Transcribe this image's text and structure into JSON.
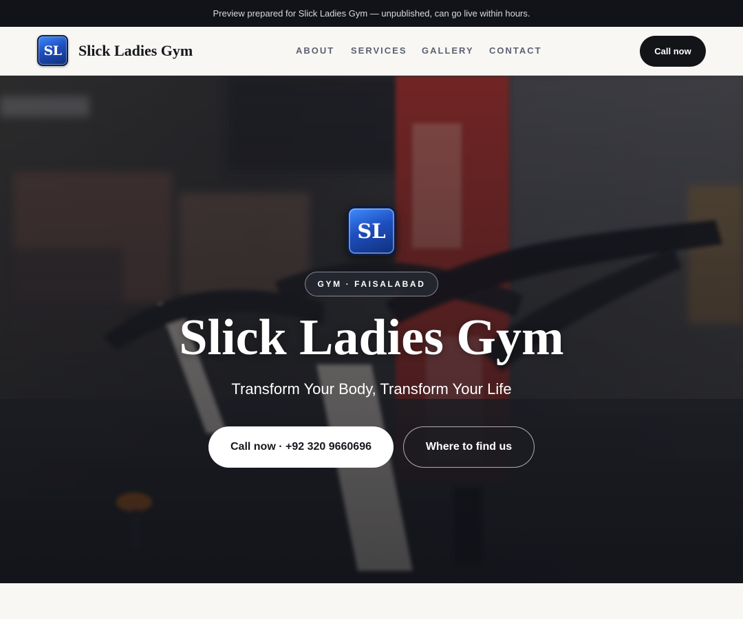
{
  "preview_bar": {
    "text": "Preview prepared for Slick Ladies Gym — unpublished, can go live within hours."
  },
  "header": {
    "logo_text": "SL",
    "brand_name": "Slick Ladies Gym",
    "nav": [
      {
        "label": "ABOUT"
      },
      {
        "label": "SERVICES"
      },
      {
        "label": "GALLERY"
      },
      {
        "label": "CONTACT"
      }
    ],
    "cta_label": "Call now"
  },
  "hero": {
    "logo_text": "SL",
    "pill_text": "GYM · FAISALABAD",
    "title": "Slick Ladies Gym",
    "subtitle": "Transform Your Body, Transform Your Life",
    "primary_button": "Call now · +92 320 9660696",
    "secondary_button": "Where to find us",
    "background": "photo of spin bikes in a gym interior"
  },
  "colors": {
    "top_bar": "#111318",
    "page_background": "#f8f7f4",
    "dark_button": "#121418",
    "logo_blue": "#1f4fbf",
    "nav_text": "#5b6170"
  }
}
